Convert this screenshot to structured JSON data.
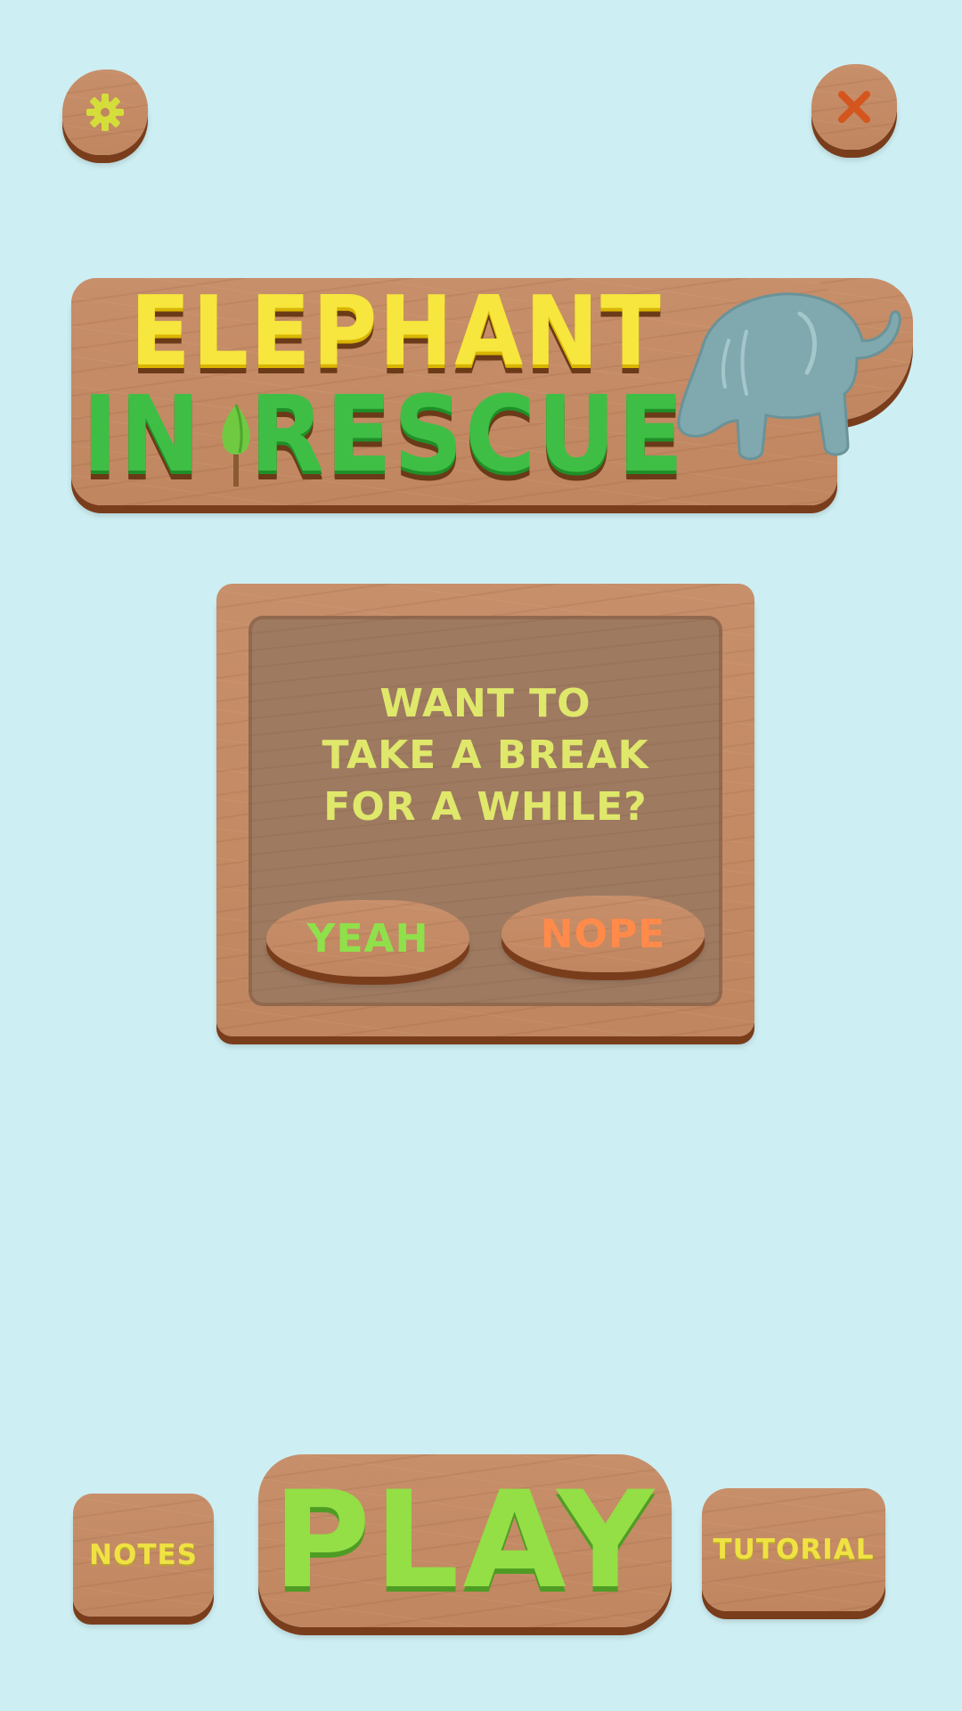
{
  "logo": {
    "line1": "ELEPHANT",
    "line2_part1": "IN",
    "line2_part2": "RESCUE"
  },
  "top_bar": {
    "settings_icon": "gear-icon",
    "close_icon": "close-icon"
  },
  "dialog": {
    "question": "WANT TO\nTAKE A BREAK\nFOR A WHILE?",
    "yes_label": "YEAH",
    "no_label": "NOPE"
  },
  "bottom_bar": {
    "notes_label": "NOTES",
    "play_label": "PLAY",
    "tutorial_label": "TUTORIAL"
  },
  "colors": {
    "background": "#cdeef2",
    "wood": "#c08660",
    "wood_dark": "#7a3d1c",
    "title_yellow": "#f6e63e",
    "title_green": "#3fbe45",
    "gear": "#d5dd3a",
    "close_x": "#d4561e",
    "yes_text": "#8fe04a",
    "no_text": "#ff8a4a",
    "question_text": "#dfe86a",
    "elephant": "#7fa9ae"
  }
}
